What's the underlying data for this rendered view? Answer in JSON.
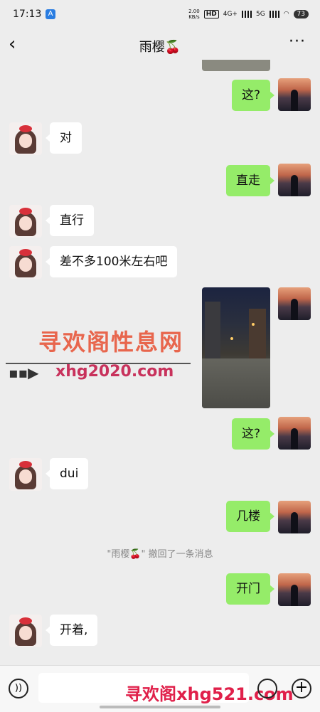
{
  "status_bar": {
    "time": "17:13",
    "app_icon_label": "A",
    "speed": "2.00\nKB/s",
    "hd": "HD",
    "net1": "4G+",
    "net2": "5G",
    "battery": "73"
  },
  "header": {
    "title": "雨樱🍒",
    "back_icon": "chevron-left-icon",
    "more_icon": "more-icon"
  },
  "messages": [
    {
      "from": "me",
      "text": "这?"
    },
    {
      "from": "her",
      "text": "对"
    },
    {
      "from": "me",
      "text": "直走"
    },
    {
      "from": "her",
      "text": "直行"
    },
    {
      "from": "her",
      "text": "差不多100米左右吧"
    },
    {
      "from": "me",
      "type": "image"
    },
    {
      "from": "me",
      "text": "这?"
    },
    {
      "from": "her",
      "text": "dui"
    },
    {
      "from": "me",
      "text": "几楼"
    },
    {
      "from": "system",
      "text": "\"雨樱🍒\" 撤回了一条消息"
    },
    {
      "from": "me",
      "text": "开门"
    },
    {
      "from": "her",
      "text": "开着,"
    }
  ],
  "watermark": {
    "title": "寻欢阁性息网",
    "url": "xhg2020.com",
    "footer": "寻欢阁xhg521.com"
  },
  "input_bar": {
    "voice_icon": "voice-icon",
    "emoji_icon": "emoji-icon",
    "plus_icon": "plus-icon"
  }
}
